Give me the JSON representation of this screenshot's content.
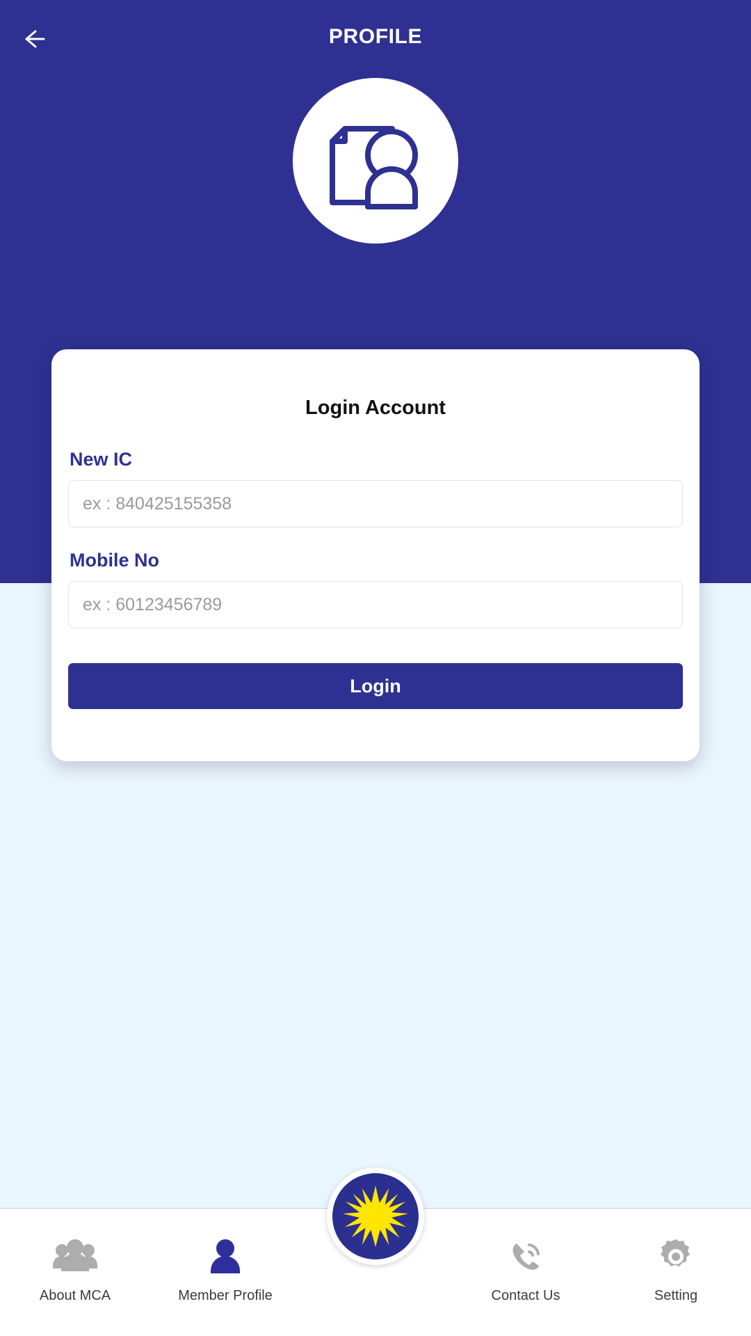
{
  "theme": {
    "brand_blue": "#2e3191",
    "page_bg": "#eaf6fd",
    "card_bg": "#ffffff",
    "label_blue": "#2e3191",
    "placeholder_gray": "#9a9a9a",
    "nav_inactive_gray": "#adadad",
    "nav_active_blue": "#2e2f9c",
    "logo_star_yellow": "#ffe600"
  },
  "appbar": {
    "title": "PROFILE",
    "back_icon": "arrow-left-icon"
  },
  "hero": {
    "avatar_icon": "document-person-profile-icon"
  },
  "card": {
    "title": "Login Account",
    "fields": [
      {
        "label": "New IC",
        "placeholder": "ex : 840425155358",
        "value": "",
        "name": "new-ic"
      },
      {
        "label": "Mobile No",
        "placeholder": "ex : 60123456789",
        "value": "",
        "name": "mobile-no"
      }
    ],
    "submit_label": "Login"
  },
  "bottom_nav": {
    "items": [
      {
        "label": "About MCA",
        "icon": "people-group-icon",
        "active": false
      },
      {
        "label": "Member Profile",
        "icon": "person-icon",
        "active": true
      },
      {
        "label": "Contact Us",
        "icon": "phone-call-icon",
        "active": false
      },
      {
        "label": "Setting",
        "icon": "gear-icon",
        "active": false
      }
    ],
    "center_logo": {
      "icon": "mca-star-logo-icon"
    }
  }
}
